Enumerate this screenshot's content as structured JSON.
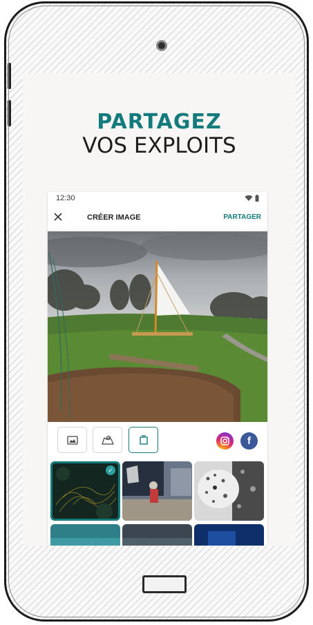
{
  "headline": {
    "line1": "PARTAGEZ",
    "line2": "VOS EXPLOITS"
  },
  "status_bar": {
    "time": "12:30",
    "icons": [
      "wifi-icon",
      "battery-icon"
    ]
  },
  "toolbar": {
    "close_icon": "close-icon",
    "title": "CRÉER IMAGE",
    "share_label": "PARTAGER"
  },
  "image_tools": [
    {
      "name": "photo-tool",
      "icon": "image-icon",
      "active": false
    },
    {
      "name": "map-tool",
      "icon": "map-pin-icon",
      "active": false
    },
    {
      "name": "frame-tool",
      "icon": "frame-icon",
      "active": true
    }
  ],
  "social": [
    {
      "name": "instagram-button",
      "icon": "instagram-icon"
    },
    {
      "name": "facebook-button",
      "icon": "facebook-icon",
      "glyph": "f"
    }
  ],
  "colors": {
    "accent": "#137b7b",
    "headline_dark": "#1d1d1d",
    "facebook": "#3b5998"
  },
  "templates": {
    "selected_index": 0,
    "visible_count": 6
  }
}
